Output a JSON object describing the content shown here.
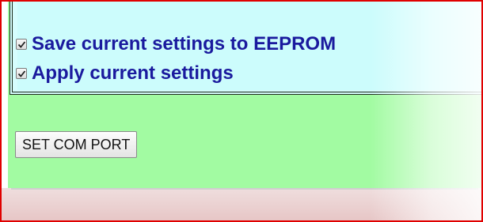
{
  "settings": {
    "options": [
      {
        "label": "Save current settings to EEPROM",
        "checked": true
      },
      {
        "label": "Apply current settings",
        "checked": true
      }
    ]
  },
  "actions": {
    "set_com_port_label": "SET COM PORT"
  },
  "colors": {
    "frame_border": "#e00000",
    "panel_green": "#a2fba2",
    "settings_bg": "#ccfcfc",
    "label_text": "#1a1a9e",
    "bottom_pink": "#e6c4c4"
  }
}
